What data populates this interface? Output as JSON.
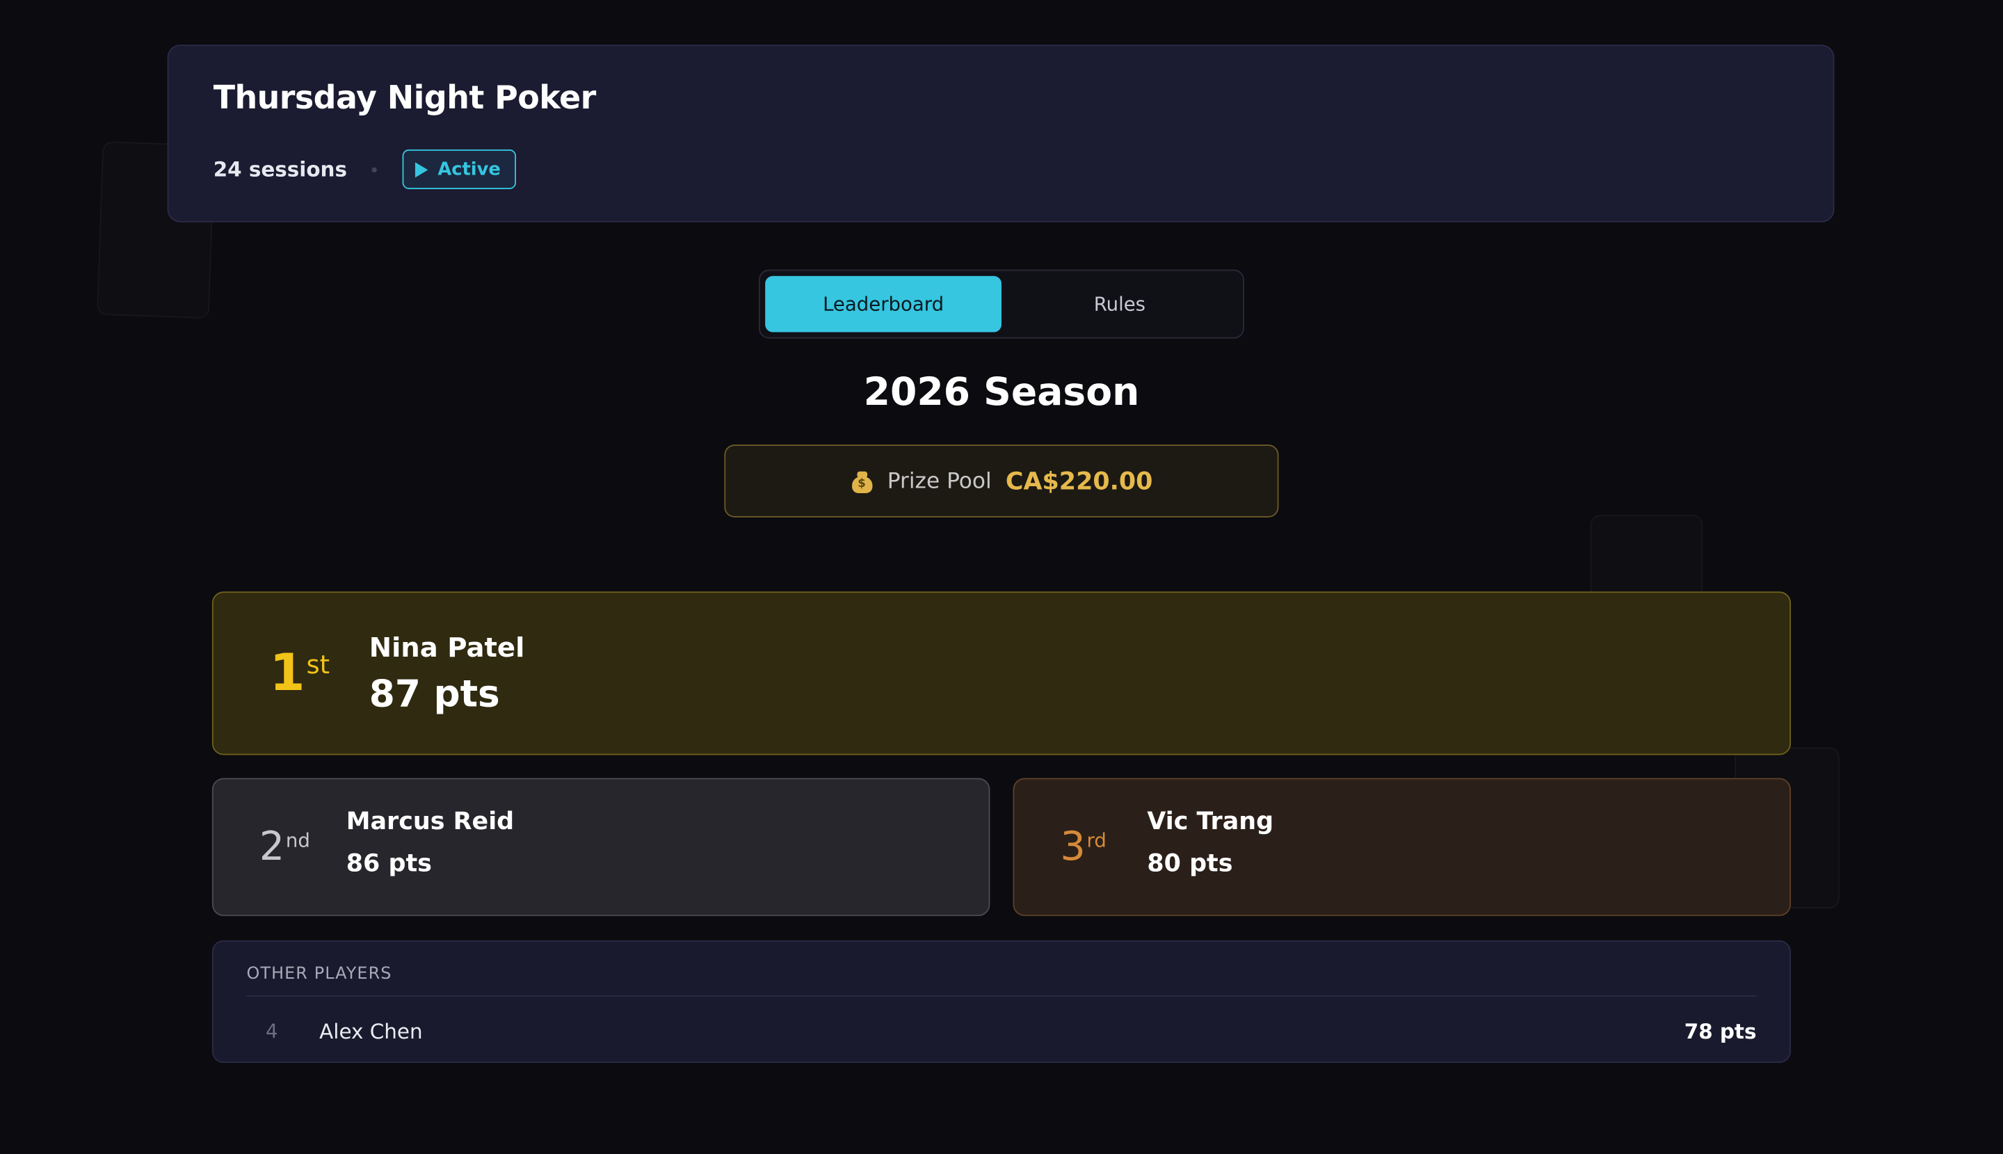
{
  "header": {
    "title": "Thursday Night Poker",
    "sessions": "24 sessions",
    "status": "Active"
  },
  "tabs": [
    {
      "label": "Leaderboard",
      "active": true
    },
    {
      "label": "Rules",
      "active": false
    }
  ],
  "season": {
    "title": "2026 Season",
    "prize_label": "Prize Pool",
    "prize_value": "CA$220.00",
    "prize_icon": "money-bag-icon",
    "bag_sign": "$"
  },
  "podium": [
    {
      "rank": "1",
      "suffix": "st",
      "name": "Nina Patel",
      "points": "87 pts"
    },
    {
      "rank": "2",
      "suffix": "nd",
      "name": "Marcus Reid",
      "points": "86 pts"
    },
    {
      "rank": "3",
      "suffix": "rd",
      "name": "Vic Trang",
      "points": "80 pts"
    }
  ],
  "others": {
    "heading": "OTHER PLAYERS",
    "players": [
      {
        "rank": "4",
        "name": "Alex Chen",
        "points": "78 pts"
      }
    ]
  },
  "colors": {
    "accent": "#36c6e0",
    "gold": "#f2c318",
    "silver": "#c8c8cc",
    "bronze": "#d68a38",
    "prize": "#e6b94c"
  }
}
